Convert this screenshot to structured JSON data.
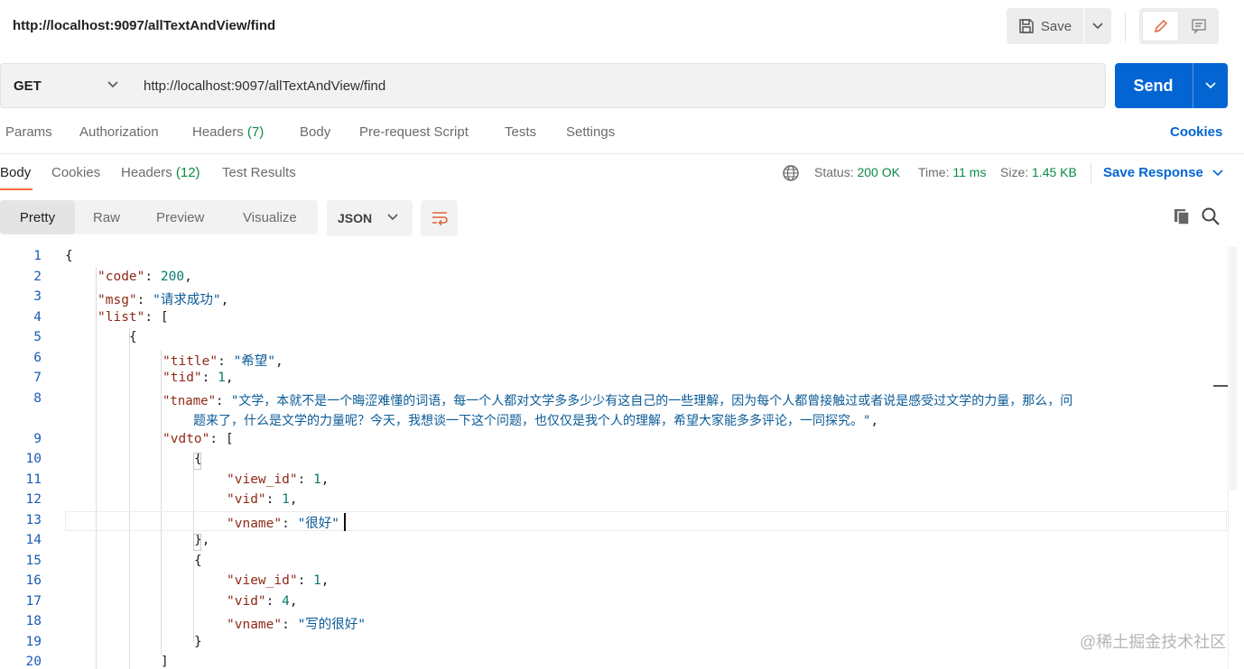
{
  "request": {
    "title": "http://localhost:9097/allTextAndView/find",
    "method": "GET",
    "url": "http://localhost:9097/allTextAndView/find",
    "save_label": "Save",
    "send_label": "Send"
  },
  "request_tabs": {
    "params": "Params",
    "authorization": "Authorization",
    "headers": "Headers",
    "headers_count": "(7)",
    "body": "Body",
    "pre_request": "Pre-request Script",
    "tests": "Tests",
    "settings": "Settings",
    "cookies": "Cookies"
  },
  "response_tabs": {
    "body": "Body",
    "cookies": "Cookies",
    "headers": "Headers",
    "headers_count": "(12)",
    "test_results": "Test Results"
  },
  "response_status": {
    "status_label": "Status:",
    "status_value": "200 OK",
    "time_label": "Time:",
    "time_value": "11 ms",
    "size_label": "Size:",
    "size_value": "1.45 KB",
    "save_response": "Save Response"
  },
  "view_tabs": {
    "pretty": "Pretty",
    "raw": "Raw",
    "preview": "Preview",
    "visualize": "Visualize",
    "format": "JSON"
  },
  "code": {
    "line_numbers": [
      "1",
      "2",
      "3",
      "4",
      "5",
      "6",
      "7",
      "8",
      "",
      "9",
      "10",
      "11",
      "12",
      "13",
      "14",
      "15",
      "16",
      "17",
      "18",
      "19",
      "20"
    ],
    "keys": {
      "code": "\"code\"",
      "msg": "\"msg\"",
      "list": "\"list\"",
      "title": "\"title\"",
      "tid": "\"tid\"",
      "tname": "\"tname\"",
      "vdto": "\"vdto\"",
      "view_id": "\"view_id\"",
      "vid": "\"vid\"",
      "vname": "\"vname\""
    },
    "values": {
      "code": "200",
      "msg": "\"请求成功\"",
      "title": "\"希望\"",
      "tid": "1",
      "tname_1": "\"文学，本就不是一个晦涩难懂的词语，每一个人都对文学多多少少有这自己的一些理解，因为每个人都曾接触过或者说是感受过文学的力量，那么，问",
      "tname_2": "题来了，什么是文学的力量呢？今天，我想谈一下这个问题，也仅仅是我个人的理解，希望大家能多多评论，一同探究。\"",
      "v1_view_id": "1",
      "v1_vid": "1",
      "v1_vname": "\"很好\"",
      "v2_view_id": "1",
      "v2_vid": "4",
      "v2_vname": "\"写的很好\""
    }
  },
  "watermark": "@稀土掘金技术社区",
  "colors": {
    "accent_orange": "#ff6c37",
    "send_blue": "#0265d2",
    "status_green": "#0a8a46"
  }
}
